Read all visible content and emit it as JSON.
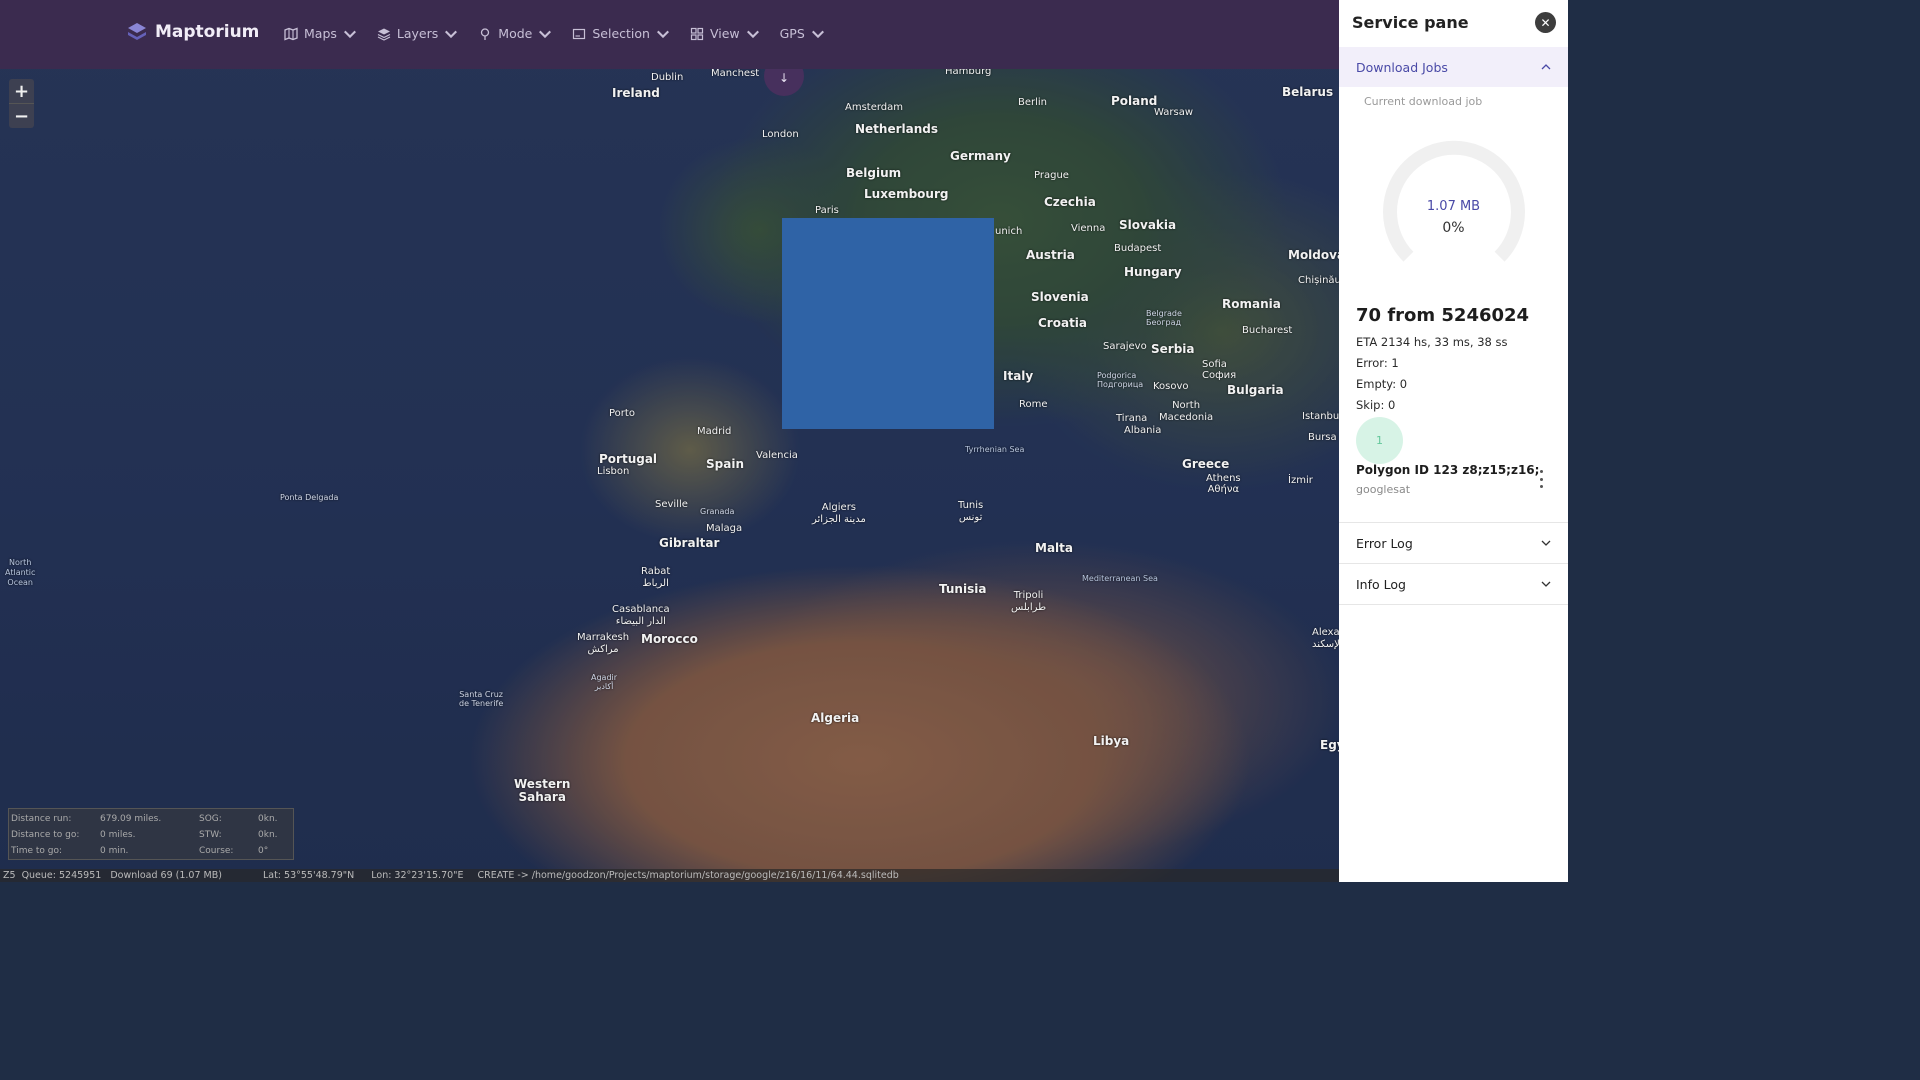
{
  "app": {
    "name": "Maptorium"
  },
  "nav": [
    {
      "label": "Maps",
      "icon": "map-icon"
    },
    {
      "label": "Layers",
      "icon": "layers-icon"
    },
    {
      "label": "Mode",
      "icon": "pin-icon"
    },
    {
      "label": "Selection",
      "icon": "selection-icon"
    },
    {
      "label": "View",
      "icon": "grid-icon"
    },
    {
      "label": "GPS",
      "icon": ""
    }
  ],
  "zoom": {
    "in": "+",
    "out": "−"
  },
  "map_labels": {
    "ireland": "Ireland",
    "dublin": "Dublin",
    "manchester": "Manchest",
    "london": "London",
    "hamburg": "Hamburg",
    "amsterdam": "Amsterdam",
    "netherlands": "Netherlands",
    "berlin": "Berlin",
    "poland": "Poland",
    "warsaw": "Warsaw",
    "belarus": "Belarus",
    "germany": "Germany",
    "belgium": "Belgium",
    "luxembourg": "Luxembourg",
    "paris": "Paris",
    "prague": "Prague",
    "czechia": "Czechia",
    "munich": "unich",
    "vienna": "Vienna",
    "slovakia": "Slovakia",
    "budapest": "Budapest",
    "austria": "Austria",
    "hungary": "Hungary",
    "moldova": "Moldova",
    "chisinau": "Chișinău",
    "slovenia": "Slovenia",
    "croatia": "Croatia",
    "romania": "Romania",
    "belgrade": "Belgrade\nБеоград",
    "bucharest": "Bucharest",
    "sarajevo": "Sarajevo",
    "serbia": "Serbia",
    "sofia": "Sofia\nСофия",
    "podgorica": "Podgorica\nПодгорица",
    "kosovo": "Kosovo",
    "bulgaria": "Bulgaria",
    "italy": "Italy",
    "rome": "Rome",
    "tirana": "Tirana",
    "albania": "Albania",
    "north_macedonia": "North\nMacedonia",
    "istanbul": "Istanbu",
    "bursa": "Bursa",
    "porto": "Porto",
    "madrid": "Madrid",
    "portugal": "Portugal",
    "lisbon": "Lisbon",
    "spain": "Spain",
    "valencia": "Valencia",
    "tyrrhenian": "Tyrrhenian Sea",
    "greece": "Greece",
    "athens": "Athens\nΑθήνα",
    "izmir": "İzmir",
    "ponta_delgada": "Ponta Delgada",
    "seville": "Seville",
    "granada": "Granada",
    "malaga": "Malaga",
    "algiers": "Algiers\nمدينة الجزائر",
    "tunis": "Tunis\nتونس",
    "gibraltar": "Gibraltar",
    "malta": "Malta",
    "north_atlantic": "North\nAtlantic\nOcean",
    "rabat": "Rabat\nالرباط",
    "mediterranean": "Mediterranean Sea",
    "tunisia": "Tunisia",
    "tripoli": "Tripoli\nطرابلس",
    "casablanca": "Casablanca\nالدار البيضاء",
    "alexandria": "Alexa\nالإسكند",
    "marrakesh": "Marrakesh\nمراكش",
    "morocco": "Morocco",
    "agadir": "Agadir\nأكادير",
    "santa_cruz": "Santa Cruz\nde Tenerife",
    "algeria": "Algeria",
    "libya": "Libya",
    "egypt": "Egy",
    "western_sahara": "Western\nSahara"
  },
  "navinfo": {
    "distance_run_label": "Distance run:",
    "distance_run": "679.09 miles.",
    "sog_label": "SOG:",
    "sog": "0kn.",
    "distance_to_go_label": "Distance to go:",
    "distance_to_go": "0 miles.",
    "stw_label": "STW:",
    "stw": "0kn.",
    "time_to_go_label": "Time to go:",
    "time_to_go": "0 min.",
    "course_label": "Course:",
    "course": "0°"
  },
  "statusbar": {
    "zoom": "Z5",
    "queue": "Queue: 5245951",
    "download": "Download 69 (1.07 MB)",
    "lat": "Lat: 53°55'48.79\"N",
    "lon": "Lon: 32°23'15.70\"E",
    "create": "CREATE -> /home/goodzon/Projects/maptorium/storage/google/z16/16/11/64.44.sqlitedb"
  },
  "pane": {
    "title": "Service pane",
    "download_jobs": "Download Jobs",
    "current_job_label": "Current download job",
    "gauge_size": "1.07 MB",
    "gauge_percent": "0%",
    "gauge_progress": 0,
    "count": "70 from 5246024",
    "eta": "ETA 2134 hs, 33 ms, 38 ss",
    "error": "Error: 1",
    "empty": "Empty: 0",
    "skip": "Skip: 0",
    "avatar": "1",
    "job_name": "Polygon ID 123 z8;z15;z16;",
    "job_source": "googlesat",
    "error_log": "Error Log",
    "info_log": "Info Log"
  },
  "colors": {
    "topbar": "#3b2b4f",
    "accent": "#4a4aa7",
    "selection": "#2f63a6",
    "avatar_bg": "#d7f3e6"
  }
}
